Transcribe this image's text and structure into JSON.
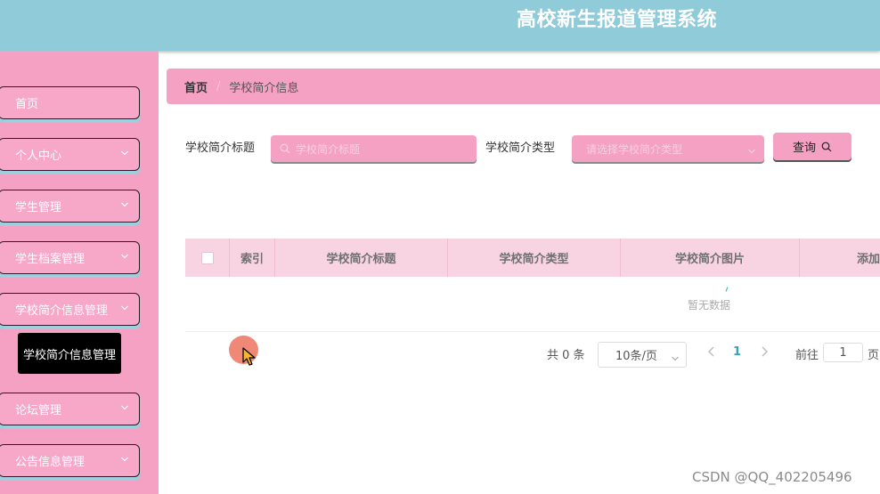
{
  "header": {
    "title": "高校新生报道管理系统"
  },
  "sidebar": {
    "items": [
      {
        "label": "首页",
        "has_chevron": false
      },
      {
        "label": "个人中心",
        "has_chevron": true
      },
      {
        "label": "学生管理",
        "has_chevron": true
      },
      {
        "label": "学生档案管理",
        "has_chevron": true
      },
      {
        "label": "学校简介信息管理",
        "has_chevron": true
      },
      {
        "label": "论坛管理",
        "has_chevron": true
      },
      {
        "label": "公告信息管理",
        "has_chevron": true
      }
    ],
    "active_sub_item": "学校简介信息管理"
  },
  "breadcrumb": {
    "home": "首页",
    "separator": "/",
    "current": "学校简介信息"
  },
  "search": {
    "title_label": "学校简介标题",
    "title_placeholder": "学校简介标题",
    "type_label": "学校简介类型",
    "type_placeholder": "请选择学校简介类型",
    "query_button": "查询"
  },
  "table": {
    "columns": [
      "索引",
      "学校简介标题",
      "学校简介类型",
      "学校简介图片",
      "添加"
    ],
    "empty_text": "暂无数据"
  },
  "pagination": {
    "total": "共 0 条",
    "page_size": "10条/页",
    "current_page": "1",
    "goto_label": "前往",
    "goto_value": "1",
    "goto_suffix": "页"
  },
  "watermark": "CSDN @QQ_402205496",
  "colors": {
    "header_bg": "#8fcbd8",
    "sidebar_bg": "#f4a1c3",
    "accent_teal": "#39a3ad",
    "table_header_bg": "#f8d4e2"
  },
  "icons": {
    "search": "search-icon",
    "chevron": "chevron-down-icon",
    "cursor": "cursor-arrow-icon"
  }
}
